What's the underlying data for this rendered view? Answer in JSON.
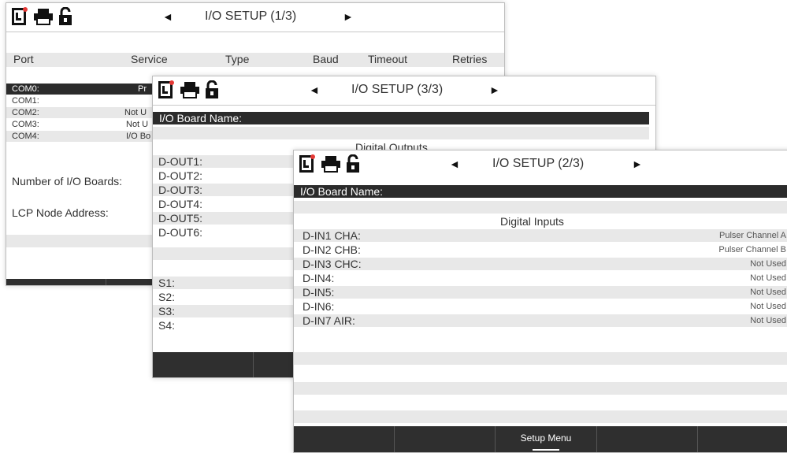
{
  "window1": {
    "title": "I/O SETUP (1/3)",
    "nav_prev": "◄",
    "nav_next": "►",
    "columns": [
      "Port",
      "Service",
      "Type",
      "Baud",
      "Timeout",
      "Retries"
    ],
    "ports": [
      {
        "port": "COM0:",
        "service": "Pr"
      },
      {
        "port": "COM1:",
        "service": ""
      },
      {
        "port": "COM2:",
        "service": "Not U"
      },
      {
        "port": "COM3:",
        "service": "Not U"
      },
      {
        "port": "COM4:",
        "service": "I/O Bo"
      }
    ],
    "num_boards_label": "Number of I/O Boards:",
    "lcp_node_label": "LCP Node Address:"
  },
  "window3": {
    "title": "I/O SETUP (3/3)",
    "nav_prev": "◄",
    "nav_next": "►",
    "board_name_label": "I/O Board Name:",
    "section_title": "Digital Outputs",
    "outputs": [
      "D-OUT1:",
      "D-OUT2:",
      "D-OUT3:",
      "D-OUT4:",
      "D-OUT5:",
      "D-OUT6:"
    ],
    "s_items": [
      "S1:",
      "S2:",
      "S3:",
      "S4:"
    ]
  },
  "window2": {
    "title": "I/O SETUP (2/3)",
    "nav_prev": "◄",
    "nav_next": "►",
    "board_name_label": "I/O Board Name:",
    "section_title": "Digital Inputs",
    "inputs": [
      {
        "label": "D-IN1 CHA:",
        "value": "Pulser Channel A"
      },
      {
        "label": "D-IN2 CHB:",
        "value": "Pulser Channel B"
      },
      {
        "label": "D-IN3 CHC:",
        "value": "Not Used"
      },
      {
        "label": "D-IN4:",
        "value": "Not Used"
      },
      {
        "label": "D-IN5:",
        "value": "Not Used"
      },
      {
        "label": "D-IN6:",
        "value": "Not Used"
      },
      {
        "label": "D-IN7 AIR:",
        "value": "Not Used"
      }
    ],
    "footer_buttons": [
      "",
      "",
      "Setup Menu",
      "",
      ""
    ]
  },
  "colors": {
    "dark_bar": "#2b2b2b",
    "shade": "#e8e8e8",
    "logo_red": "#e53935"
  }
}
